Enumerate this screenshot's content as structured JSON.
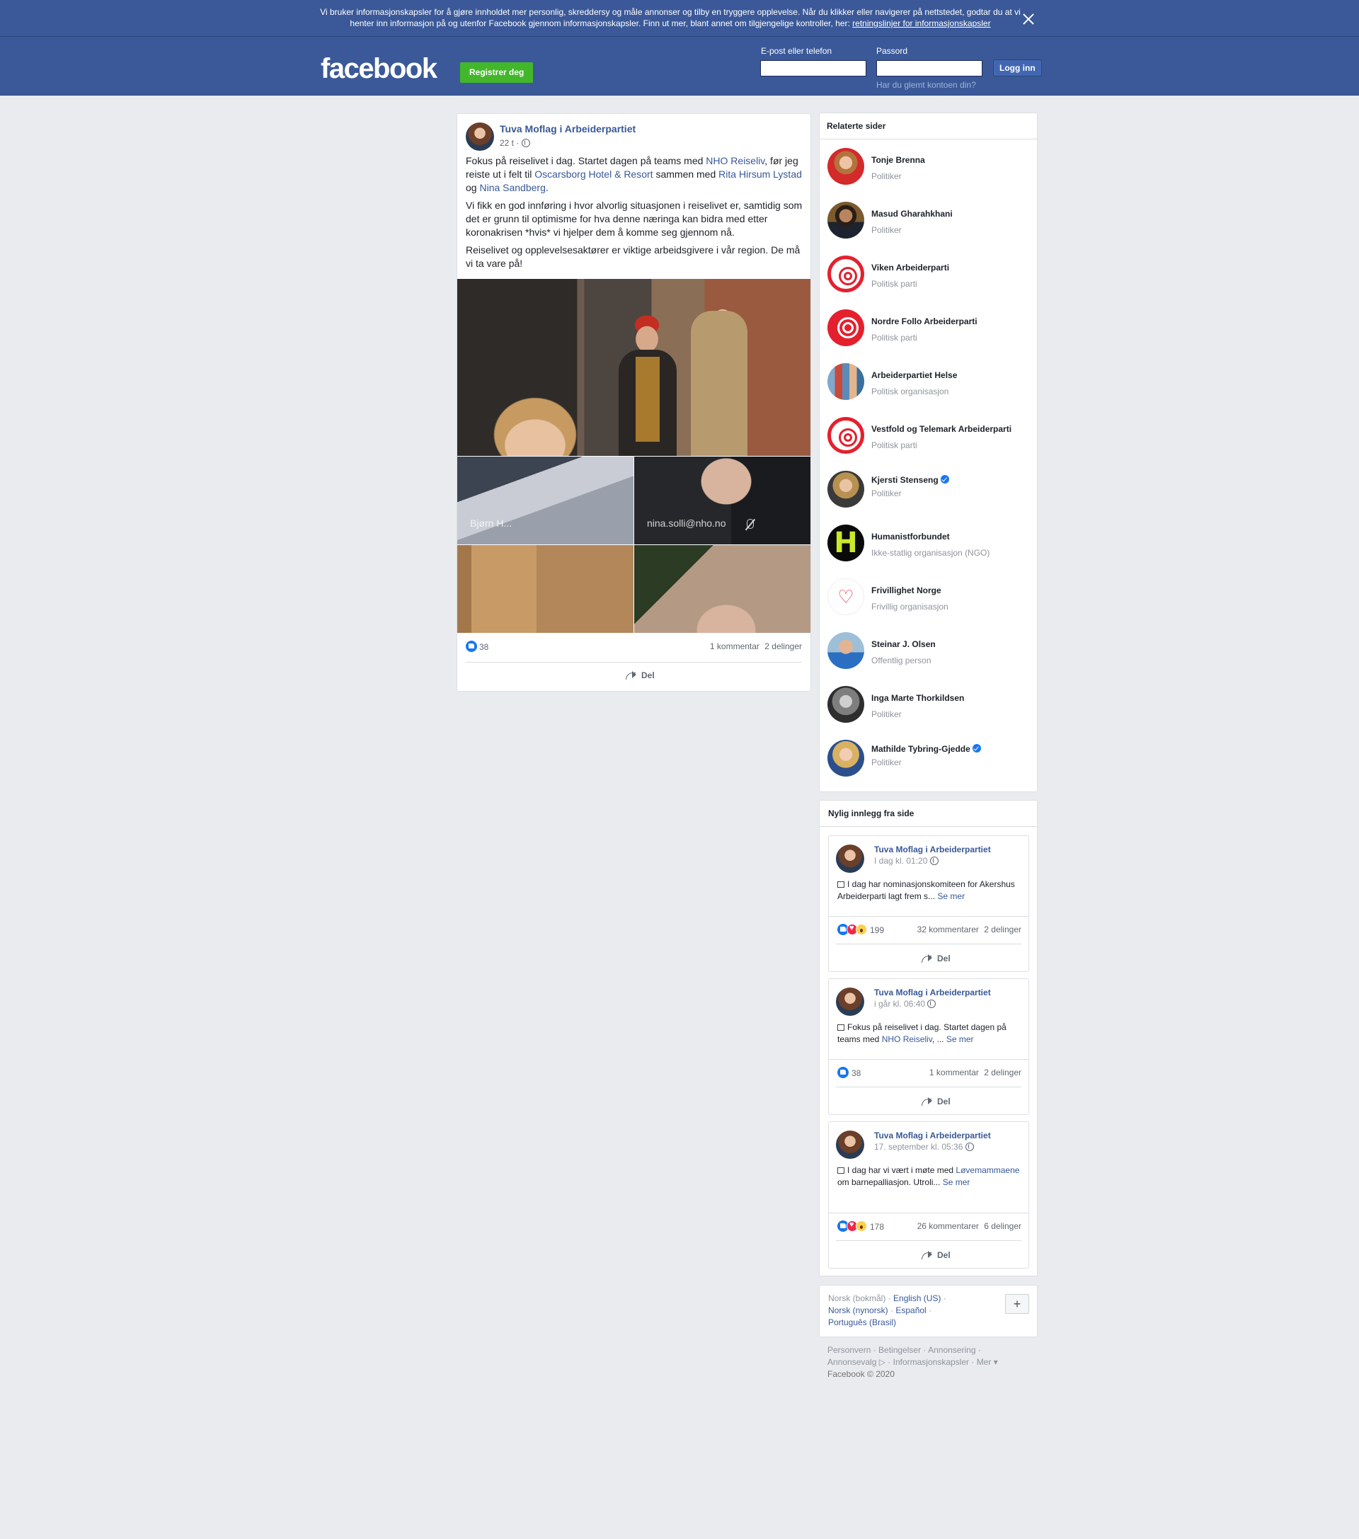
{
  "cookie_banner": {
    "text": "Vi bruker informasjonskapsler for å gjøre innholdet mer personlig, skreddersy og måle annonser og tilby en tryggere opplevelse. Når du klikker eller navigerer på nettstedet, godtar du at vi henter inn informasjon på og utenfor Facebook gjennom informasjonskapsler. Finn ut mer, blant annet om tilgjengelige kontroller, her: ",
    "link": "retningslinjer for informasjonskapsler"
  },
  "header": {
    "logo": "facebook",
    "register": "Registrer deg",
    "email_label": "E-post eller telefon",
    "password_label": "Passord",
    "login": "Logg inn",
    "forgot": "Har du glemt kontoen din?"
  },
  "post": {
    "author": "Tuva Moflag i Arbeiderpartiet",
    "time": "22 t",
    "p1": {
      "t1": "Fokus på reiselivet i dag. Startet dagen på teams med ",
      "l1": "NHO Reiseliv",
      "t2": ", før jeg reiste ut i felt til ",
      "l2": "Oscarsborg Hotel & Resort",
      "t3": " sammen med ",
      "l3": "Rita Hirsum Lystad",
      "t4": " og ",
      "l4": "Nina Sandberg",
      "t5": "."
    },
    "p2": "Vi fikk en god innføring i hvor alvorlig situasjonen i reiselivet er, samtidig som det er grunn til optimisme for hva denne næringa kan bidra med etter koronakrisen *hvis* vi hjelper dem å komme seg gjennom nå.",
    "p3": "Reiselivet og opplevelsesaktører er viktige arbeidsgivere i vår region. De må vi ta vare på!",
    "video_name_1": "Bjørn H...",
    "video_name_2": "nina.solli@nho.no",
    "likes": "38",
    "comments": "1 kommentar",
    "shares": "2 delinger",
    "share": "Del"
  },
  "related": {
    "title": "Relaterte sider",
    "items": [
      {
        "name": "Tonje Brenna",
        "sub": "Politiker"
      },
      {
        "name": "Masud Gharahkhani",
        "sub": "Politiker"
      },
      {
        "name": "Viken Arbeiderparti",
        "sub": "Politisk parti"
      },
      {
        "name": "Nordre Follo Arbeiderparti",
        "sub": "Politisk parti"
      },
      {
        "name": "Arbeiderpartiet Helse",
        "sub": "Politisk organisasjon"
      },
      {
        "name": "Vestfold og Telemark Arbeiderparti",
        "sub": "Politisk parti"
      },
      {
        "name": "Kjersti Stenseng",
        "sub": "Politiker"
      },
      {
        "name": "Humanistforbundet",
        "sub": "Ikke-statlig organisasjon (NGO)"
      },
      {
        "name": "Frivillighet Norge",
        "sub": "Frivillig organisasjon"
      },
      {
        "name": "Steinar J. Olsen",
        "sub": "Offentlig person"
      },
      {
        "name": "Inga Marte Thorkildsen",
        "sub": "Politiker"
      },
      {
        "name": "Mathilde Tybring-Gjedde",
        "sub": "Politiker"
      }
    ]
  },
  "recent": {
    "title": "Nylig innlegg fra side",
    "posts": [
      {
        "author": "Tuva Moflag i Arbeiderpartiet",
        "time": "I dag kl. 01:20",
        "text": "I dag har nominasjonskomiteen for Akershus Arbeiderparti lagt frem s...",
        "link": "",
        "text2": "",
        "more": "Se mer",
        "count": "199",
        "comments": "32 kommentarer",
        "shares": "2 delinger",
        "share": "Del"
      },
      {
        "author": "Tuva Moflag i Arbeiderpartiet",
        "time": "i går kl. 06:40",
        "text": "Fokus på reiselivet i dag. Startet dagen på teams med ",
        "link": "NHO Reiseliv",
        "text2": ", ... ",
        "more": "Se mer",
        "count": "38",
        "comments": "1 kommentar",
        "shares": "2 delinger",
        "share": "Del"
      },
      {
        "author": "Tuva Moflag i Arbeiderpartiet",
        "time": "17. september kl. 05:36",
        "text": "I dag har vi vært i møte med ",
        "link": "Løvemammaene",
        "text2": " om barnepalliasjon. Utroli... ",
        "more": "Se mer",
        "count": "178",
        "comments": "26 kommentarer",
        "shares": "6 delinger",
        "share": "Del"
      }
    ]
  },
  "languages": {
    "current": "Norsk (bokmål)",
    "others": [
      "English (US)",
      "Norsk (nynorsk)",
      "Español",
      "Português (Brasil)"
    ],
    "plus": "+"
  },
  "footer": {
    "links": [
      "Personvern",
      "Betingelser",
      "Annonsering",
      "Annonsevalg",
      "Informasjonskapsler",
      "Mer"
    ],
    "copyright": "Facebook © 2020"
  }
}
